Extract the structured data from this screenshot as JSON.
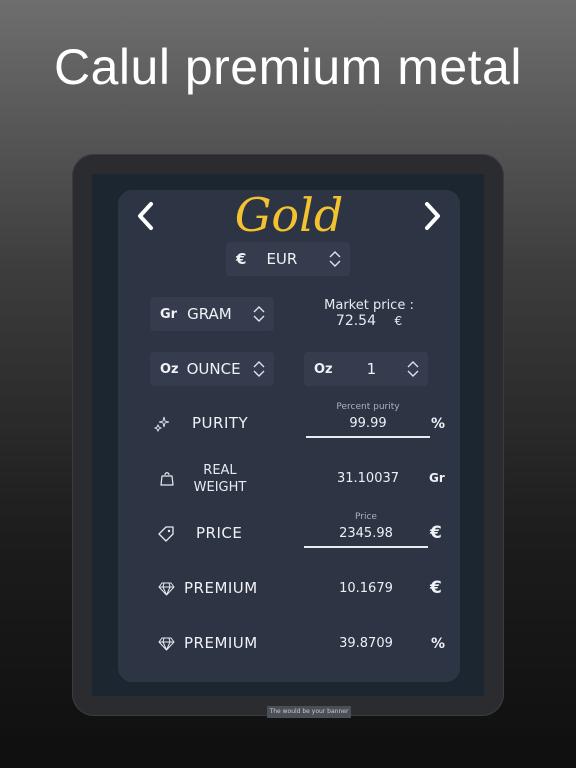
{
  "headline": "Calul premium metal",
  "app": {
    "title": "Gold",
    "currency": {
      "symbol": "€",
      "code": "EUR"
    },
    "unit_select": {
      "prefix": "Gr",
      "value": "GRAM"
    },
    "market_price": {
      "label": "Market price :",
      "value": "72.54",
      "symbol": "€"
    },
    "ounce_select": {
      "prefix": "Oz",
      "value": "OUNCE"
    },
    "qty_select": {
      "prefix": "Oz",
      "value": "1"
    },
    "rows": {
      "purity": {
        "label": "PURITY",
        "hint": "Percent purity",
        "value": "99.99",
        "unit": "%"
      },
      "weight": {
        "label_line1": "REAL",
        "label_line2": "WEIGHT",
        "value": "31.10037",
        "unit": "Gr"
      },
      "price": {
        "label": "PRICE",
        "hint": "Price",
        "value": "2345.98",
        "unit": "€"
      },
      "premium_eur": {
        "label": "PREMIUM",
        "value": "10.1679",
        "unit": "€"
      },
      "premium_pct": {
        "label": "PREMIUM",
        "value": "39.8709",
        "unit": "%"
      }
    },
    "footer": "The would be your banner"
  },
  "colors": {
    "accent": "#f2c230",
    "panel": "#2d3444",
    "screen": "#1b2630"
  }
}
